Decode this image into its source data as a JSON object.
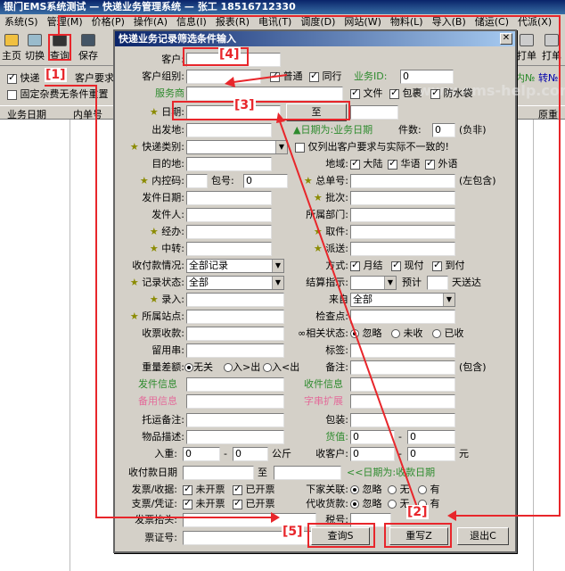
{
  "window": {
    "title": "银门EMS系统测试 — 快递业务管理系统 — 张工 18516712330"
  },
  "menu": [
    "系统(S)",
    "管理(M)",
    "价格(P)",
    "操作(A)",
    "信息(I)",
    "报表(R)",
    "电讯(T)",
    "调度(D)",
    "网站(W)",
    "物料(L)",
    "导入(B)",
    "储运(C)",
    "代派(X)"
  ],
  "toolbar": {
    "home": "主页",
    "switch": "切换",
    "query": "查询",
    "save": "保存",
    "print": "打单",
    "dispatch": "打单",
    "inner_no": "内№",
    "transfer_no": "转№"
  },
  "options": {
    "express_label": "快递",
    "customer_req": "客户要求",
    "fixed_cost": "固定杂费无条件重置"
  },
  "grid": {
    "col_date": "业务日期",
    "col_inner": "内单号",
    "col_right": "原重"
  },
  "dialog": {
    "title": "快递业务记录筛选条件输入",
    "watermark": "www.ems-help.com",
    "watermark2": "www.ems-help.com",
    "labels": {
      "customer": "客户:",
      "customer_group": "客户组别:",
      "service_provider": "服务商",
      "date": "日期:",
      "to": "至",
      "date_note": "▲日期为:业务日期",
      "piece_count": "件数:",
      "piece_val": "0",
      "piece_suffix": "(负非)",
      "origin": "出发地:",
      "express_type": "快递类别:",
      "only_mismatch": "仅列出客户要求与实际不一致的!",
      "destination": "目的地:",
      "region": "地域:",
      "inner_code": "内控码:",
      "package": "包号:",
      "package_val": "0",
      "master_no": "总单号:",
      "master_note": "(左包含)",
      "send_date": "发件日期:",
      "batch": "批次:",
      "sender": "发件人:",
      "dept": "所属部门:",
      "handler": "经办:",
      "pickup": "取件:",
      "transit": "中转:",
      "deliver": "派送:",
      "pay_status": "收付款情况:",
      "pay_val": "全部记录",
      "method": "方式:",
      "record_status": "记录状态:",
      "record_val": "全部",
      "settle": "结算指示:",
      "forecast": "预计",
      "days": "天送达",
      "entry": "录入:",
      "from": "来自",
      "from_val": "全部",
      "station": "所属站点:",
      "checkpoint": "检查点:",
      "recv_no": "收票收款:",
      "related": "∞相关状态:",
      "ignore": "忽略",
      "unrecv": "未收",
      "recv": "已收",
      "stay": "留用串:",
      "tag": "标签:",
      "weight_diff": "重量差额:",
      "none": "无关",
      "in_out": "入>出",
      "in_lt": "入<出",
      "remark": "备注:",
      "contain": "(包含)",
      "sender_info": "发件信息",
      "recv_info": "收件信息",
      "spare_info": "备用信息",
      "char_ext": "字串扩展",
      "consign_note": "托运备注:",
      "pack": "包装:",
      "goods_desc": "物品描述:",
      "goods_value": "货值:",
      "gv_a": "0",
      "gv_b": "0",
      "weight_in": "入重:",
      "w_a": "0",
      "w_b": "0",
      "kg": "公斤",
      "recv_customer": "收客户:",
      "rc_a": "0",
      "rc_b": "0",
      "yuan": "元",
      "pay_date": "收付款日期",
      "to2": "至",
      "date_note2": "<<日期为:收款日期",
      "invoice": "发票/收据:",
      "not_issued": "未开票",
      "issued": "已开票",
      "branch": "下家关联:",
      "ignore2": "忽略",
      "none2": "无",
      "have": "有",
      "voucher": "支票/凭证:",
      "not_issued2": "未开票",
      "issued2": "已开票",
      "cod": "代收货款:",
      "ignore3": "忽略",
      "none3": "无",
      "have2": "有",
      "invoice_head": "发票抬头:",
      "tax_no": "税号:",
      "ticket_no": "票证号:",
      "normal": "普通",
      "sameline": "同行",
      "business_id": "业务ID:",
      "business_id_val": "0",
      "doc": "文件",
      "package_chk": "包裹",
      "waterproof": "防水袋",
      "mainland": "大陆",
      "hk": "华语",
      "foreign": "外语",
      "monthly": "月结",
      "cash": "现付",
      "cod_chk": "到付"
    },
    "buttons": {
      "query": "查询S",
      "rewrite": "重写Z",
      "exit": "退出C"
    }
  },
  "callouts": {
    "c1": "[1]",
    "c2": "[2]",
    "c3": "[3]",
    "c4": "[4]",
    "c5": "[5]"
  },
  "colors": {
    "annotation": "#e8262b",
    "label_green": "#2e8b2e",
    "label_pink": "#e36b9a"
  }
}
